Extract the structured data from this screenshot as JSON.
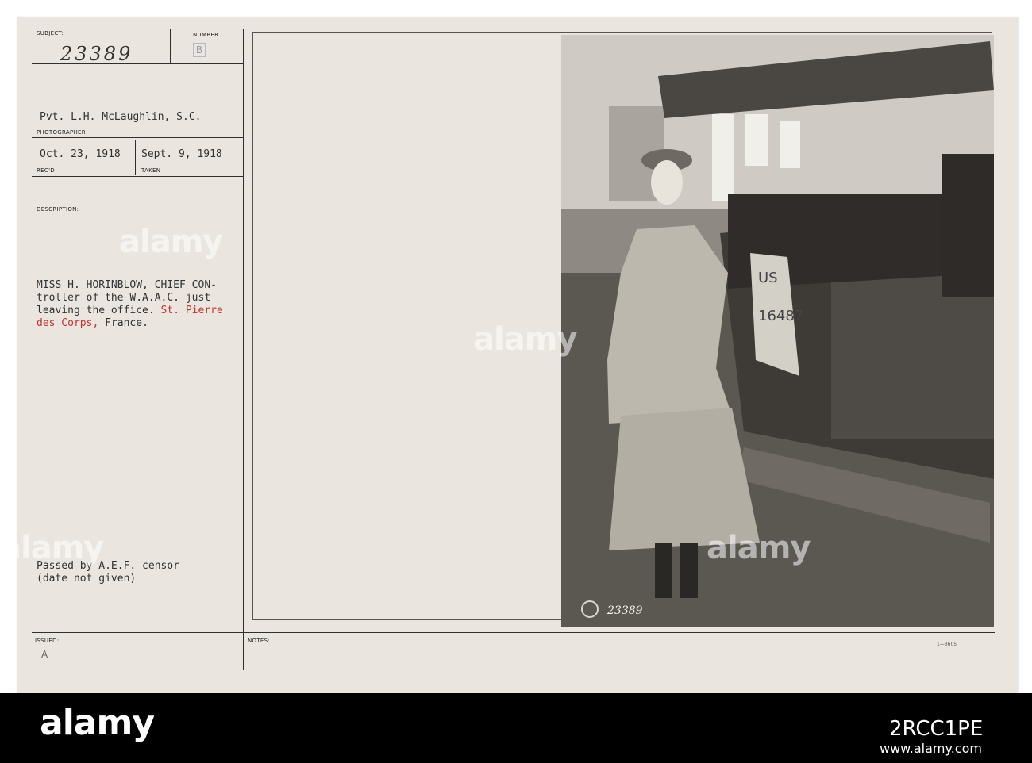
{
  "card": {
    "subject_label": "SUBJECT:",
    "subject_number": "23389",
    "number_label": "NUMBER",
    "number_stamp": "B",
    "photographer": "Pvt. L.H. McLaughlin, S.C.",
    "photographer_label": "PHOTOGRAPHER",
    "received_date": "Oct. 23, 1918",
    "received_label": "REC'D",
    "taken_date": "Sept. 9, 1918",
    "taken_label": "TAKEN",
    "description_label": "DESCRIPTION:",
    "description_line1": "MISS H. HORINBLOW, CHIEF CON-",
    "description_line2": "troller of the W.A.A.C. just",
    "description_line3_black": "leaving the office. ",
    "description_line3_red": "St. Pierre",
    "description_line4_red": "des Corps,",
    "description_line4_black": " France.",
    "censor_line1": "Passed by A.E.F. censor",
    "censor_line2": "(date not given)",
    "issued_label": "ISSUED:",
    "issued_mark": "A",
    "notes_label": "NOTES:",
    "form_code": "1—3605",
    "photo_number": "23389",
    "plate_text_1": "US",
    "plate_text_2": "16487"
  },
  "watermarks": [
    "alamy",
    "alamy",
    "alamy",
    "alamy"
  ],
  "banner": {
    "logo": "alamy",
    "image_id": "2RCC1PE",
    "url": "www.alamy.com"
  },
  "colors": {
    "card": "#eae6df",
    "ink": "#333333",
    "red_ink": "#c53232",
    "banner": "#000000"
  }
}
